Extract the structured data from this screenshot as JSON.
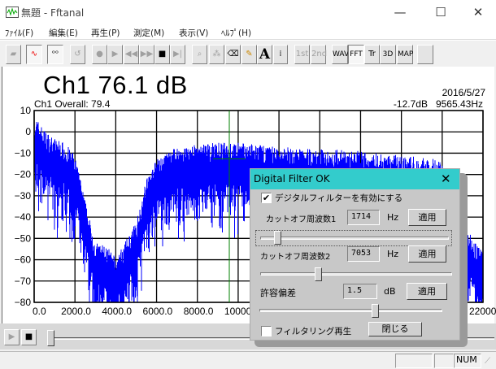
{
  "window": {
    "title": "無題 - Fftanal",
    "minimize": "—",
    "maximize": "☐",
    "close": "✕"
  },
  "menu": [
    "ﾌｧｲﾙ(F)",
    "編集(E)",
    "再生(P)",
    "測定(M)",
    "表示(V)",
    "ﾍﾙﾌﾟ(H)"
  ],
  "toolbar": {
    "first": "1st",
    "second": "2nd",
    "wav": "WAV",
    "fft": "FFT",
    "tr": "Tr",
    "3d": "3D",
    "map": "MAP",
    "text": "A"
  },
  "header": {
    "channel_level": "Ch1    76.1 dB",
    "date": "2016/5/27",
    "overall": "Ch1 Overall: 79.4",
    "cursor_readout": "-12.7dB   9565.43Hz"
  },
  "chart_data": {
    "type": "line",
    "title": "Ch1 FFT spectrum",
    "xlabel": "Hz",
    "ylabel": "dB",
    "xlim": [
      0,
      22000
    ],
    "ylim": [
      -80,
      10
    ],
    "x_ticks": [
      "0.0",
      "2000.0",
      "4000.0",
      "6000.0",
      "8000.0",
      "10000.",
      "22000."
    ],
    "y_ticks": [
      "10",
      "0",
      "-10",
      "-20",
      "-30",
      "-40",
      "-50",
      "-60",
      "-70",
      "-80"
    ],
    "grid": true,
    "cursor": {
      "freq": 9565.43,
      "level": -12.7
    },
    "envelope": [
      [
        0,
        -5
      ],
      [
        500,
        -12
      ],
      [
        1000,
        -16
      ],
      [
        1500,
        -18
      ],
      [
        2000,
        -24
      ],
      [
        2500,
        -45
      ],
      [
        3000,
        -65
      ],
      [
        3500,
        -66
      ],
      [
        4000,
        -72
      ],
      [
        4500,
        -64
      ],
      [
        5000,
        -55
      ],
      [
        5500,
        -35
      ],
      [
        6000,
        -26
      ],
      [
        7000,
        -20
      ],
      [
        8000,
        -19
      ],
      [
        9000,
        -18
      ],
      [
        10000,
        -18
      ],
      [
        12000,
        -20
      ],
      [
        16000,
        -22
      ],
      [
        20000,
        -26
      ],
      [
        20500,
        -40
      ],
      [
        21000,
        -55
      ],
      [
        22000,
        -70
      ]
    ]
  },
  "dialog": {
    "title": "Digital Filter OK",
    "close": "✕",
    "enable_label": "デジタルフィルターを有効にする",
    "enable_checked": "✔",
    "cutoff1_label": "カットオフ周波数1",
    "cutoff1_value": "1714",
    "cutoff1_unit": "Hz",
    "cutoff2_label": "カットオフ周波数2",
    "cutoff2_value": "7053",
    "cutoff2_unit": "Hz",
    "tolerance_label": "許容偏差",
    "tolerance_value": "1.5",
    "tolerance_unit": "dB",
    "apply": "適用",
    "filter_play_label": "フィルタリング再生",
    "close_button": "閉じる",
    "slider1_fraction": 0.09,
    "slider2_fraction": 0.3,
    "slider3_fraction": 0.63
  },
  "status": {
    "num": "NUM"
  },
  "colors": {
    "spectrum": "#0000ff",
    "cursor": "#008000",
    "dialog_title": "#33cccc"
  }
}
